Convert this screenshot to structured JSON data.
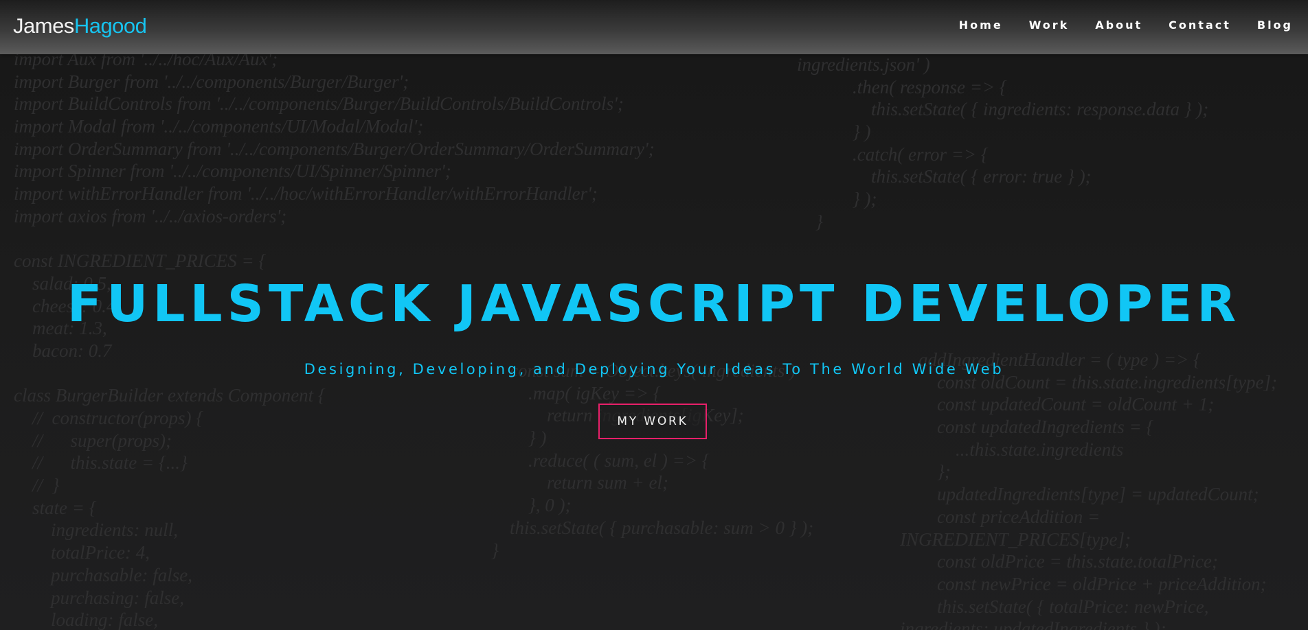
{
  "brand": {
    "first": "James",
    "last": "Hagood",
    "accent_color": "#17c4f0"
  },
  "nav": {
    "items": [
      {
        "label": "Home"
      },
      {
        "label": "Work"
      },
      {
        "label": "About"
      },
      {
        "label": "Contact"
      },
      {
        "label": "Blog"
      }
    ]
  },
  "hero": {
    "title": "FULLSTACK JAVASCRIPT DEVELOPER",
    "subtitle": "Designing, Developing, and Deploying Your Ideas To The World Wide Web",
    "cta_label": "MY WORK",
    "title_color": "#11c6f5",
    "cta_border_color": "#e8206a"
  },
  "background_code": {
    "col_a": [
      "import Aux from '../../hoc/Aux/Aux';",
      "import Burger from '../../components/Burger/Burger';",
      "import BuildControls from '../../components/Burger/BuildControls/BuildControls';",
      "import Modal from '../../components/UI/Modal/Modal';",
      "import OrderSummary from '../../components/Burger/OrderSummary/OrderSummary';",
      "import Spinner from '../../components/UI/Spinner/Spinner';",
      "import withErrorHandler from '../../hoc/withErrorHandler/withErrorHandler';",
      "import axios from '../../axios-orders';",
      "",
      "const INGREDIENT_PRICES = {",
      "    salad: 0.5,",
      "    cheese: 0.4,",
      "    meat: 1.3,",
      "    bacon: 0.7",
      "",
      "class BurgerBuilder extends Component {",
      "    //  constructor(props) {",
      "    //      super(props);",
      "    //      this.state = {...}",
      "    //  }",
      "    state = {",
      "        ingredients: null,",
      "        totalPrice: 4,",
      "        purchasable: false,",
      "        purchasing: false,",
      "        loading: false,"
    ],
    "col_b": [
      "ingredients.json' )",
      "            .then( response => {",
      "                this.setState( { ingredients: response.data } );",
      "            } )",
      "            .catch( error => {",
      "                this.setState( { error: true } );",
      "            } );",
      "    }"
    ],
    "col_c": [
      "    const sum = Object.keys( ingredients )",
      "        .map( igKey => {",
      "            return ingredients[igKey];",
      "        } )",
      "        .reduce( ( sum, el ) => {",
      "            return sum + el;",
      "        }, 0 );",
      "    this.setState( { purchasable: sum > 0 } );",
      "}"
    ],
    "col_d": [
      "    addIngredientHandler = ( type ) => {",
      "        const oldCount = this.state.ingredients[type];",
      "        const updatedCount = oldCount + 1;",
      "        const updatedIngredients = {",
      "            ...this.state.ingredients",
      "        };",
      "        updatedIngredients[type] = updatedCount;",
      "        const priceAddition =",
      "INGREDIENT_PRICES[type];",
      "        const oldPrice = this.state.totalPrice;",
      "        const newPrice = oldPrice + priceAddition;",
      "        this.setState( { totalPrice: newPrice,",
      "ingredients: updatedIngredients } );"
    ]
  }
}
